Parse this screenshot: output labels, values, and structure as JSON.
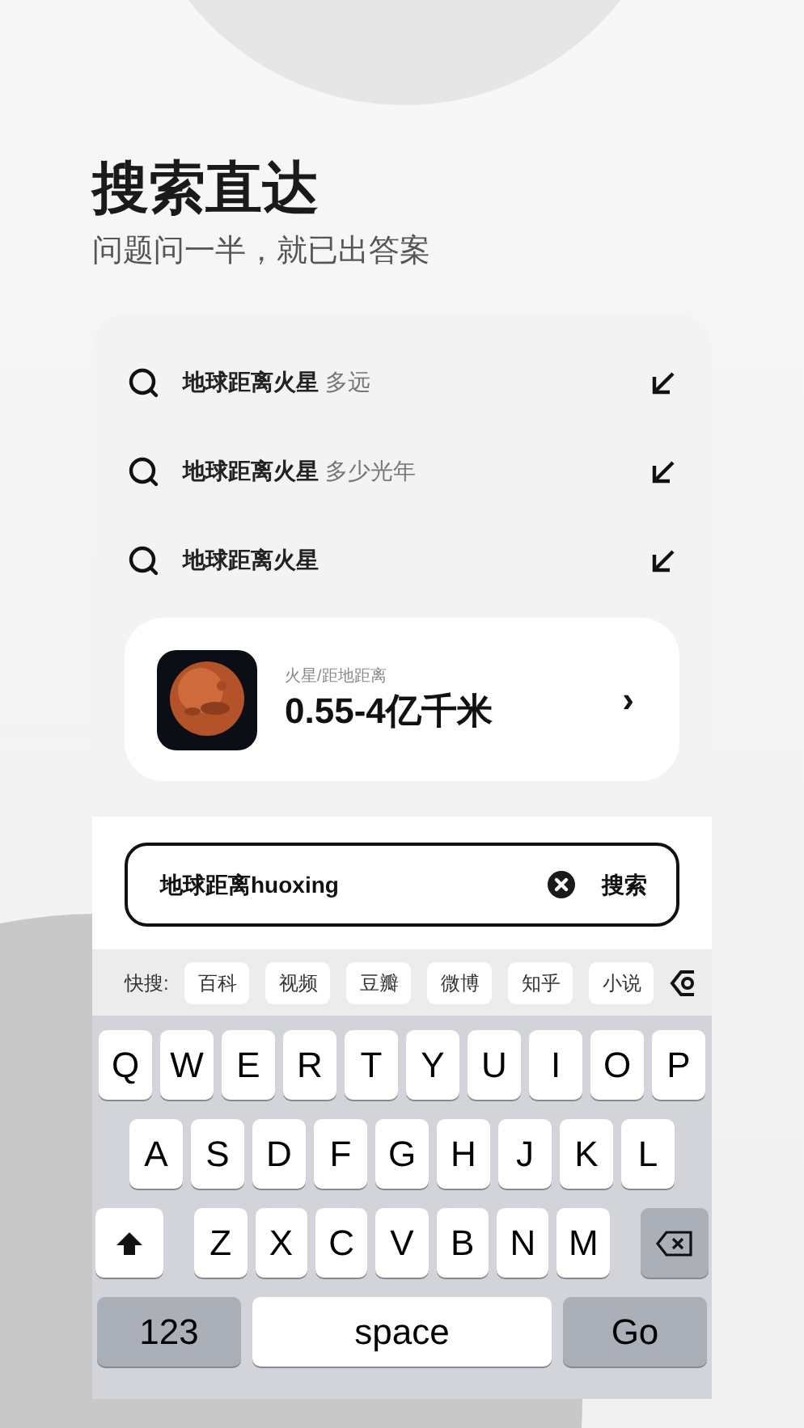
{
  "header": {
    "title": "搜索直达",
    "subtitle": "问题问一半，就已出答案"
  },
  "suggestions": [
    {
      "query": "地球距离火星",
      "suffix": "多远"
    },
    {
      "query": "地球距离火星",
      "suffix": "多少光年"
    },
    {
      "query": "地球距离火星"
    }
  ],
  "answer_card": {
    "category": "火星/距地距离",
    "value": "0.55-4亿千米",
    "chevron": "›"
  },
  "search_box": {
    "value": "地球距离huoxing",
    "button": "搜索"
  },
  "quick_search": {
    "label": "快搜:",
    "items": [
      "百科",
      "视频",
      "豆瓣",
      "微博",
      "知乎",
      "小说"
    ]
  },
  "keyboard": {
    "rows": [
      [
        "Q",
        "W",
        "E",
        "R",
        "T",
        "Y",
        "U",
        "I",
        "O",
        "P"
      ],
      [
        "A",
        "S",
        "D",
        "F",
        "G",
        "H",
        "J",
        "K",
        "L"
      ],
      [
        "Z",
        "X",
        "C",
        "V",
        "B",
        "N",
        "M"
      ]
    ],
    "number_key": "123",
    "space_key": "space",
    "go_key": "Go"
  }
}
